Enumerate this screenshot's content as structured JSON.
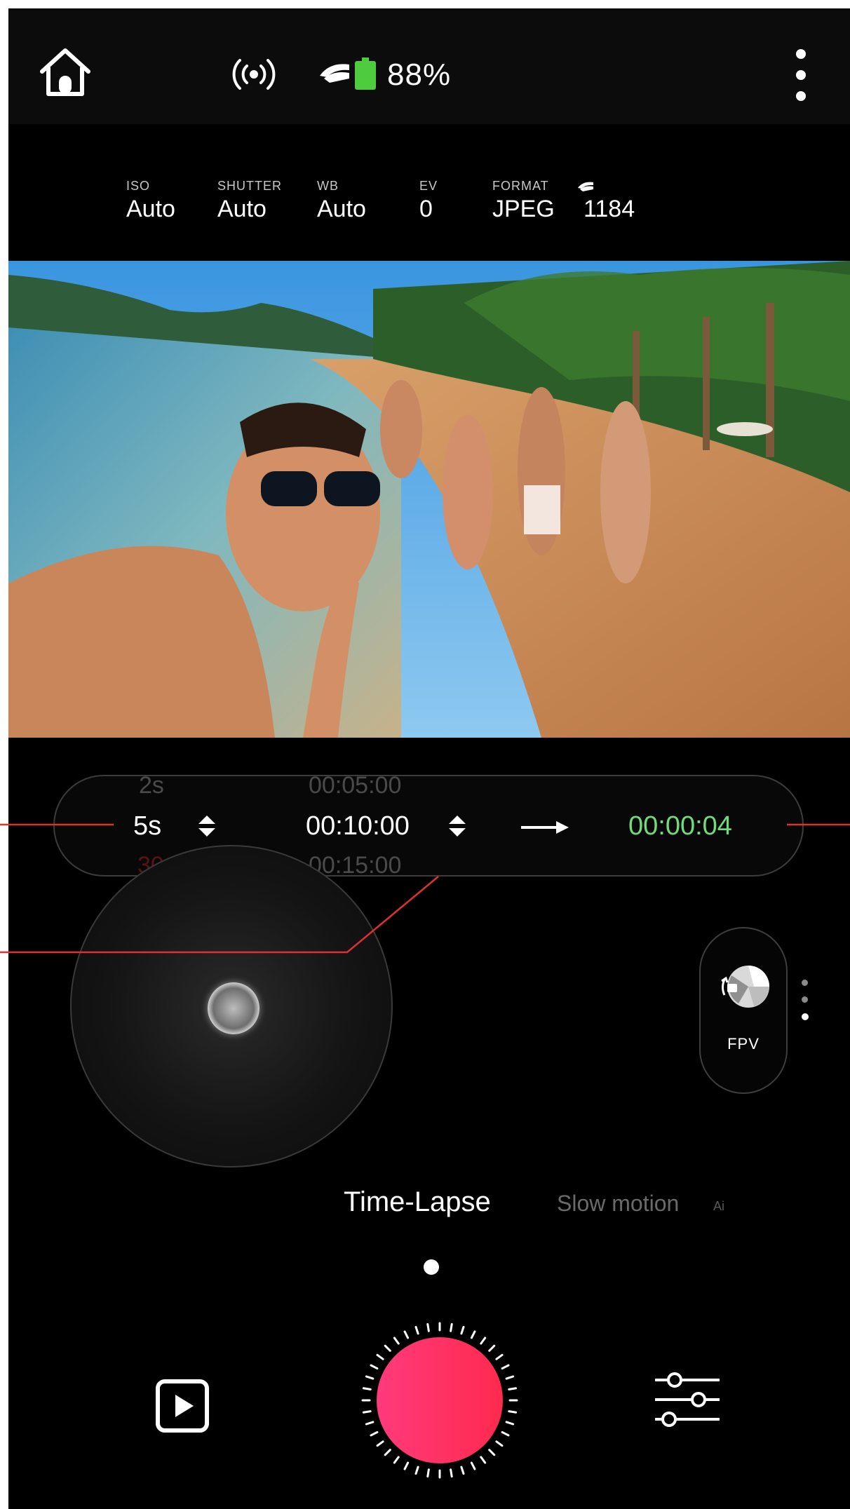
{
  "status_bar": {
    "battery_percent": "88%",
    "icons": [
      "home-icon",
      "wifi-signal-icon",
      "drone-icon",
      "battery-icon",
      "more-vertical-icon"
    ]
  },
  "camera_params": {
    "iso_label": "ISO",
    "iso_value": "Auto",
    "shutter_label": "SHUTTER",
    "shutter_value": "Auto",
    "wb_label": "WB",
    "wb_value": "Auto",
    "ev_label": "EV",
    "ev_value": "0",
    "format_label": "FORMAT",
    "format_value": "JPEG",
    "remaining_count": "1184"
  },
  "timelapse": {
    "interval_prev": "2s",
    "interval": "5s",
    "interval_next": "30s",
    "duration_prev": "00:05:00",
    "duration": "00:10:00",
    "duration_next": "00:15:00",
    "result_duration": "00:00:04"
  },
  "fpv": {
    "label": "FPV"
  },
  "modes": {
    "active": "Time-Lapse",
    "next": "Slow motion",
    "next2": "Ai"
  },
  "colors": {
    "accent_green": "#6fdc79",
    "shutter_pink": "#ff2f66",
    "annotation_red": "#e0302f"
  }
}
